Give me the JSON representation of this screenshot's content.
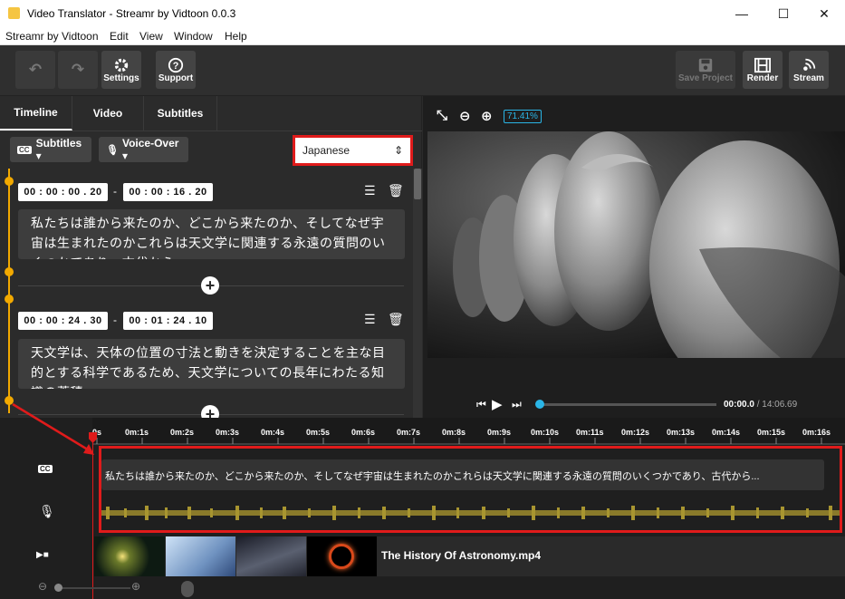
{
  "window": {
    "title": "Video Translator - Streamr by Vidtoon 0.0.3",
    "min": "—",
    "max": "☐",
    "close": "✕"
  },
  "menu": [
    "Streamr by Vidtoon",
    "Edit",
    "View",
    "Window",
    "Help"
  ],
  "toolbar": {
    "undo": "↶",
    "redo": "↷",
    "settings_label": "Settings",
    "support_label": "Support",
    "save_label": "Save Project",
    "render_label": "Render",
    "stream_label": "Stream"
  },
  "tabs": [
    "Timeline",
    "Video",
    "Subtitles"
  ],
  "controls": {
    "subtitles": "Subtitles ▾",
    "voiceover": "Voice-Over ▾",
    "cc": "CC",
    "mic": "🎙",
    "language": "Japanese",
    "lang_arrows": "⇕"
  },
  "captions": [
    {
      "start": "00 : 00 : 00 . 20",
      "end": "00 : 00 : 16 . 20",
      "text": "私たちは誰から来たのか、どこから来たのか、そしてなぜ宇宙は生まれたのかこれらは天文学に関連する永遠の質問のいくつかであり、古代から"
    },
    {
      "start": "00 : 00 : 24 . 30",
      "end": "00 : 01 : 24 . 10",
      "text": "天文学は、天体の位置の寸法と動きを決定することを主な目的とする科学であるため、天文学についての長年にわたる知識の蓄積"
    }
  ],
  "separator": "-",
  "add": "+",
  "edit_icon": "☰",
  "delete_icon": "🗑",
  "preview": {
    "zoom": "71.41%",
    "time_current": "00:00.0",
    "time_total": " / 14:06.69",
    "zoom_icons": [
      "⤡",
      "⊖",
      "⊕"
    ],
    "play_controls": [
      "⏮",
      "▶",
      "⏭"
    ]
  },
  "timeline": {
    "ticks": [
      "0s",
      "0m:1s",
      "0m:2s",
      "0m:3s",
      "0m:4s",
      "0m:5s",
      "0m:6s",
      "0m:7s",
      "0m:8s",
      "0m:9s",
      "0m:10s",
      "0m:11s",
      "0m:12s",
      "0m:13s",
      "0m:14s",
      "0m:15s",
      "0m:16s"
    ],
    "subtitle_clip": "私たちは誰から来たのか、どこから来たのか、そしてなぜ宇宙は生まれたのかこれらは天文学に関連する永遠の質問のいくつかであり、古代から...",
    "video_file": "The History Of Astronomy.mp4",
    "video_icon": "▶■",
    "zoom_out": "⊖",
    "zoom_in": "⊕"
  },
  "colors": {
    "accent": "#f2a900",
    "highlight": "#e01b1b",
    "zoom_badge": "#2ab5e6"
  }
}
